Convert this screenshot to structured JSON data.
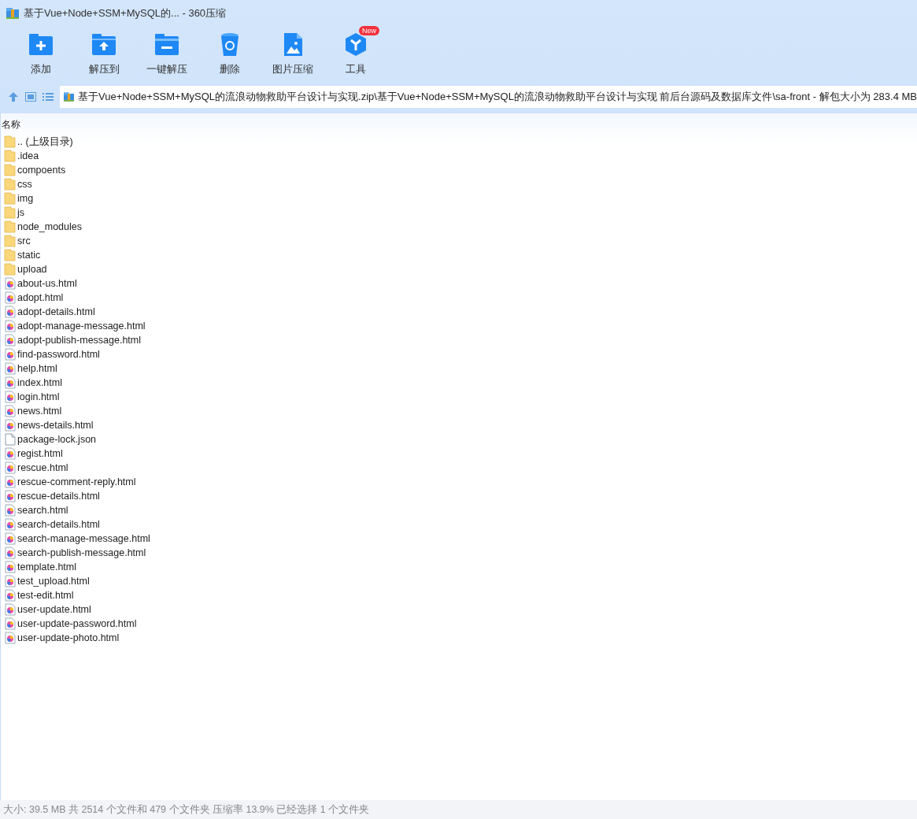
{
  "window": {
    "title": "基于Vue+Node+SSM+MySQL的... - 360压缩"
  },
  "toolbar": [
    {
      "kind": "add",
      "label": "添加"
    },
    {
      "kind": "extract-to",
      "label": "解压到"
    },
    {
      "kind": "extract",
      "label": "一键解压"
    },
    {
      "kind": "delete",
      "label": "删除"
    },
    {
      "kind": "image",
      "label": "图片压缩"
    },
    {
      "kind": "tools",
      "label": "工具",
      "badge": "New"
    }
  ],
  "address": {
    "path": "基于Vue+Node+SSM+MySQL的流浪动物救助平台设计与实现.zip\\基于Vue+Node+SSM+MySQL的流浪动物救助平台设计与实现 前后台源码及数据库文件\\sa-front - 解包大小为 283.4 MB"
  },
  "table": {
    "columns": [
      "名称"
    ],
    "rows": [
      {
        "kind": "folder",
        "name": ".. (上级目录)"
      },
      {
        "kind": "folder",
        "name": ".idea"
      },
      {
        "kind": "folder",
        "name": "compoents"
      },
      {
        "kind": "folder",
        "name": "css"
      },
      {
        "kind": "folder",
        "name": "img"
      },
      {
        "kind": "folder",
        "name": "js"
      },
      {
        "kind": "folder",
        "name": "node_modules"
      },
      {
        "kind": "folder",
        "name": "src"
      },
      {
        "kind": "folder",
        "name": "static"
      },
      {
        "kind": "folder",
        "name": "upload"
      },
      {
        "kind": "html",
        "name": "about-us.html"
      },
      {
        "kind": "html",
        "name": "adopt.html"
      },
      {
        "kind": "html",
        "name": "adopt-details.html"
      },
      {
        "kind": "html",
        "name": "adopt-manage-message.html"
      },
      {
        "kind": "html",
        "name": "adopt-publish-message.html"
      },
      {
        "kind": "html",
        "name": "find-password.html"
      },
      {
        "kind": "html",
        "name": "help.html"
      },
      {
        "kind": "html",
        "name": "index.html"
      },
      {
        "kind": "html",
        "name": "login.html"
      },
      {
        "kind": "html",
        "name": "news.html"
      },
      {
        "kind": "html",
        "name": "news-details.html"
      },
      {
        "kind": "file",
        "name": "package-lock.json"
      },
      {
        "kind": "html",
        "name": "regist.html"
      },
      {
        "kind": "html",
        "name": "rescue.html"
      },
      {
        "kind": "html",
        "name": "rescue-comment-reply.html"
      },
      {
        "kind": "html",
        "name": "rescue-details.html"
      },
      {
        "kind": "html",
        "name": "search.html"
      },
      {
        "kind": "html",
        "name": "search-details.html"
      },
      {
        "kind": "html",
        "name": "search-manage-message.html"
      },
      {
        "kind": "html",
        "name": "search-publish-message.html"
      },
      {
        "kind": "html",
        "name": "template.html"
      },
      {
        "kind": "html",
        "name": "test_upload.html"
      },
      {
        "kind": "html",
        "name": "test-edit.html"
      },
      {
        "kind": "html",
        "name": "user-update.html"
      },
      {
        "kind": "html",
        "name": "user-update-password.html"
      },
      {
        "kind": "html",
        "name": "user-update-photo.html"
      }
    ]
  },
  "status_bar": "大小: 39.5 MB 共 2514 个文件和 479 个文件夹 压缩率 13.9% 已经选择 1 个文件夹"
}
